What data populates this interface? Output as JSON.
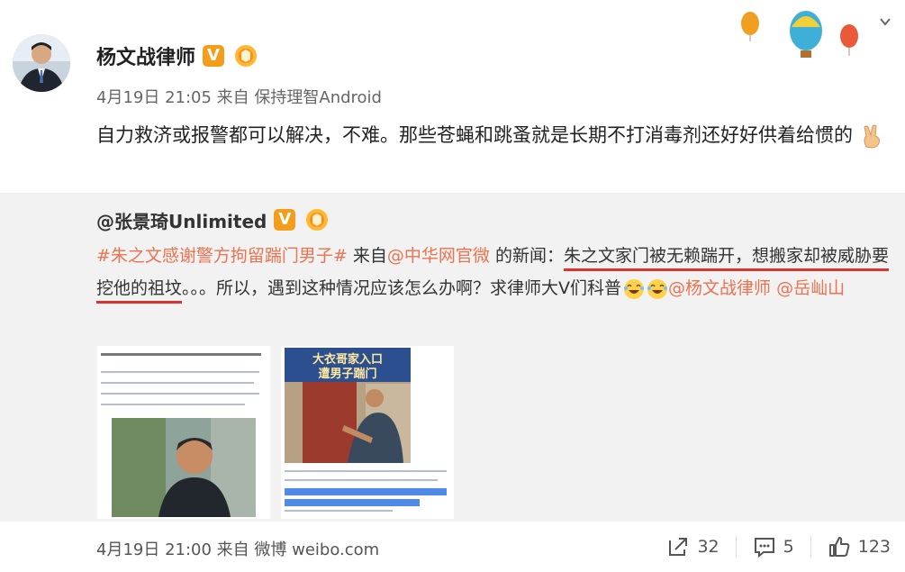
{
  "post": {
    "author": "杨文战律师",
    "meta": "4月19日 21:05 来自 保持理智Android",
    "text": "自力救济或报警都可以解决，不难。那些苍蝇和跳蚤就是长期不打消毒剂还好好供着给惯的"
  },
  "repost": {
    "author": "@张景琦Unlimited",
    "hashtag": "#朱之文感谢警方拘留踹门男子#",
    "from_label": "来自",
    "source": "@中华网官微",
    "news_label": "的新闻：",
    "underlined_text": "朱之文家门被无赖踹开，想搬家却被威胁要挖他的祖坟",
    "rest_text": "。。。所以，遇到这种情况应该怎么办啊？求律师大V们科普",
    "mention1": "@杨文战律师",
    "mention2": "@岳屾山",
    "image2_title_line1": "大衣哥家入口",
    "image2_title_line2": "遭男子踹门",
    "footer_meta": "4月19日 21:00 来自 微博 weibo.com"
  },
  "actions": {
    "repost_count": "32",
    "comment_count": "5",
    "like_count": "123"
  },
  "colors": {
    "link": "#eb7350",
    "underline": "#e03030",
    "badge": "#f49d1a",
    "repost_bg": "#f2f2f2"
  }
}
